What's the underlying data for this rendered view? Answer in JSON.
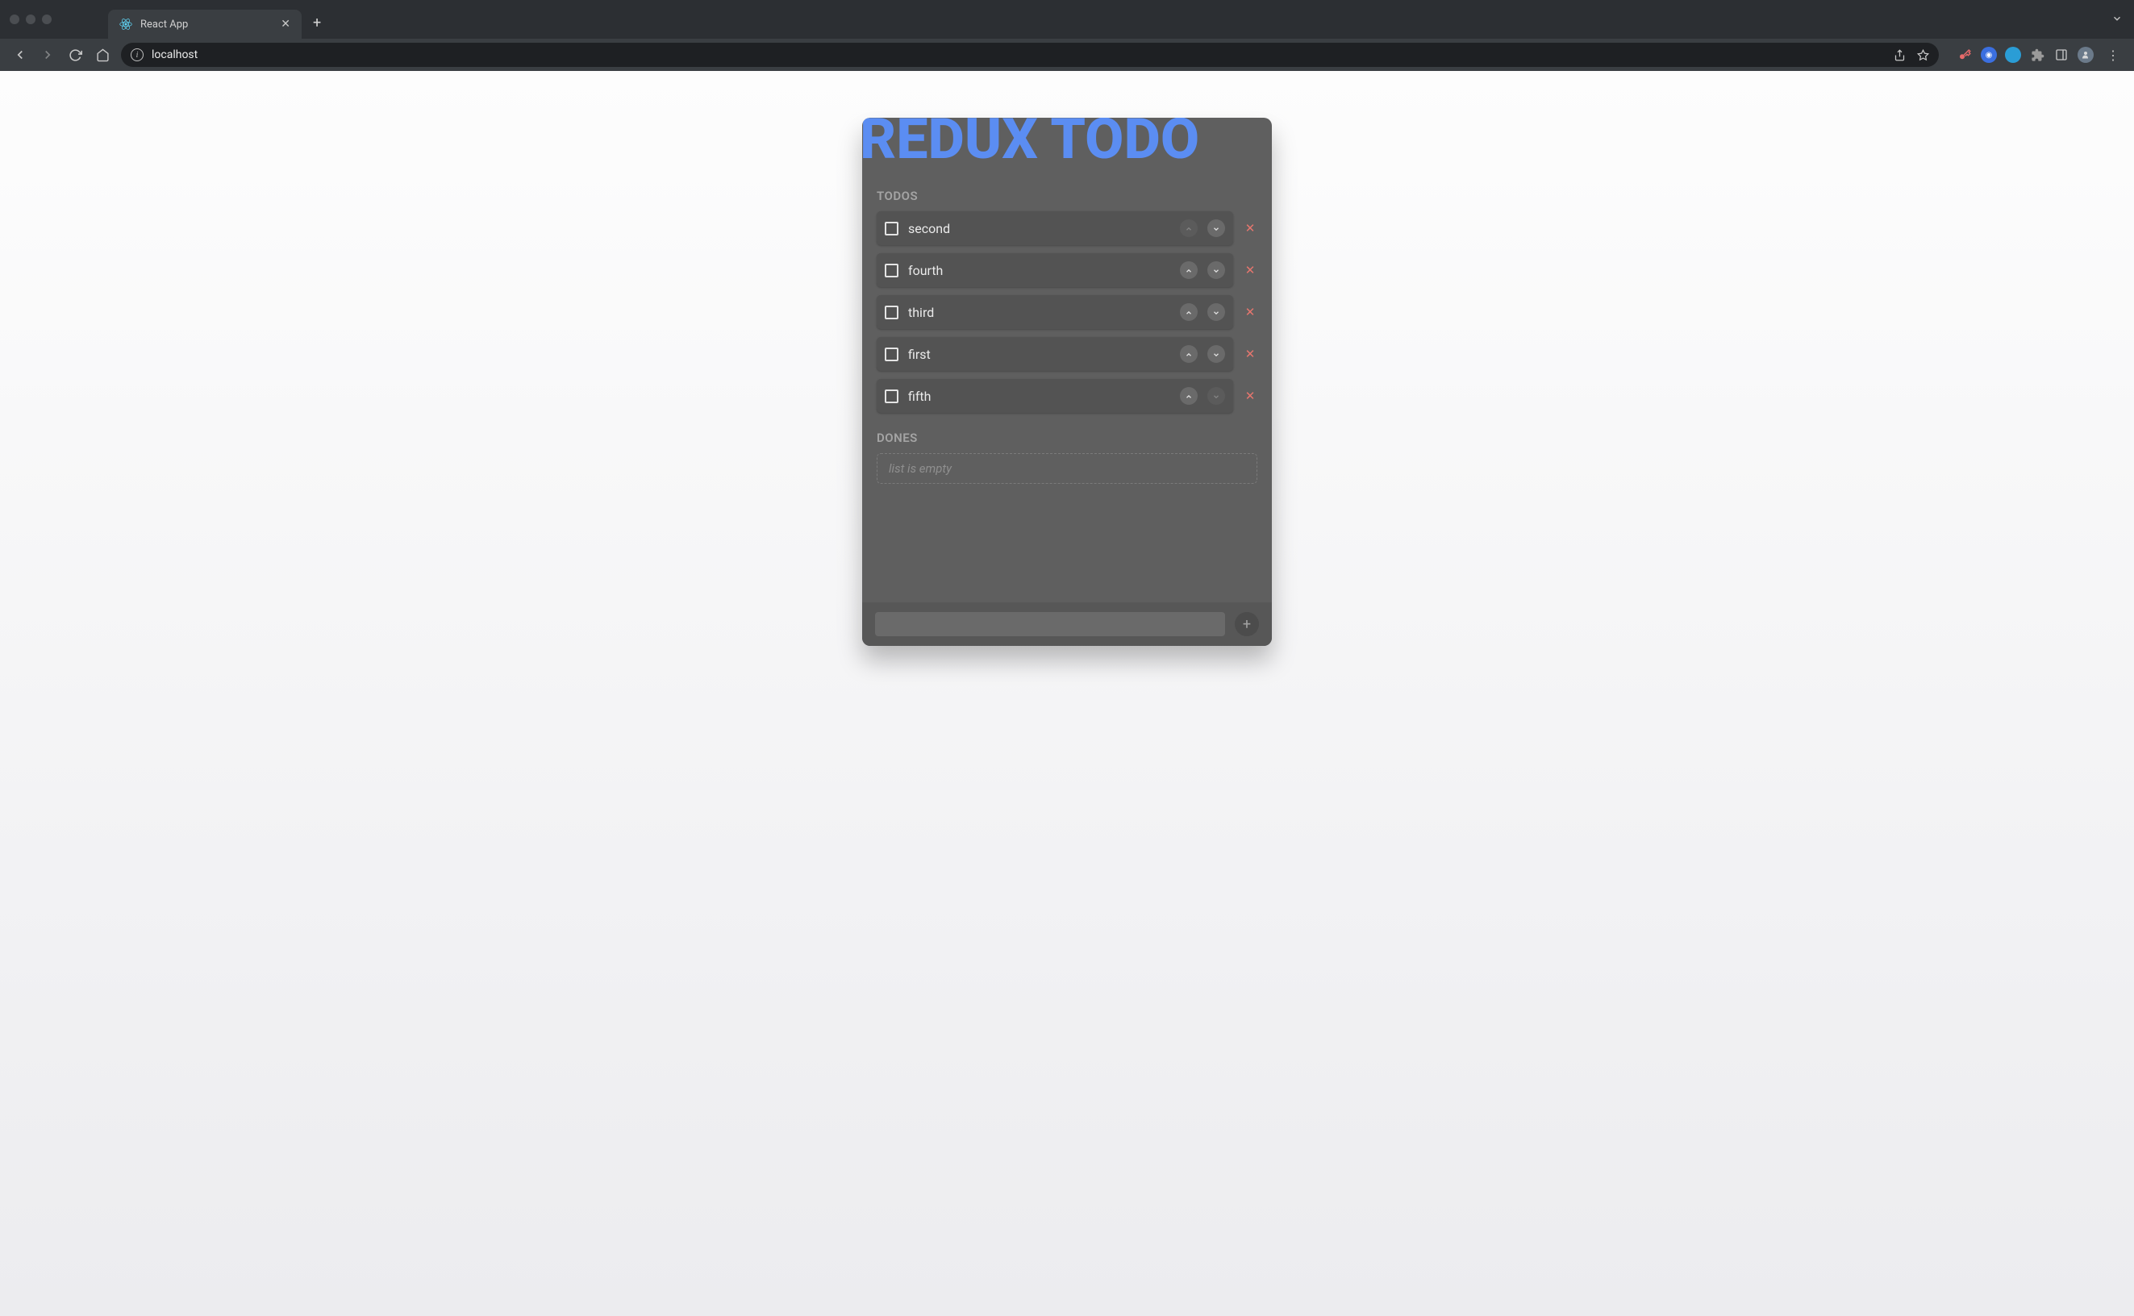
{
  "browser": {
    "tab_title": "React App",
    "address": "localhost"
  },
  "app": {
    "title": "REDUX TODO",
    "sections": {
      "todos_label": "TODOS",
      "dones_label": "DONES"
    },
    "todos": [
      {
        "text": "second",
        "up_enabled": false,
        "down_enabled": true
      },
      {
        "text": "fourth",
        "up_enabled": true,
        "down_enabled": true
      },
      {
        "text": "third",
        "up_enabled": true,
        "down_enabled": true
      },
      {
        "text": "first",
        "up_enabled": true,
        "down_enabled": true
      },
      {
        "text": "fifth",
        "up_enabled": true,
        "down_enabled": false
      }
    ],
    "dones_empty_text": "list is empty",
    "add_input_value": ""
  }
}
